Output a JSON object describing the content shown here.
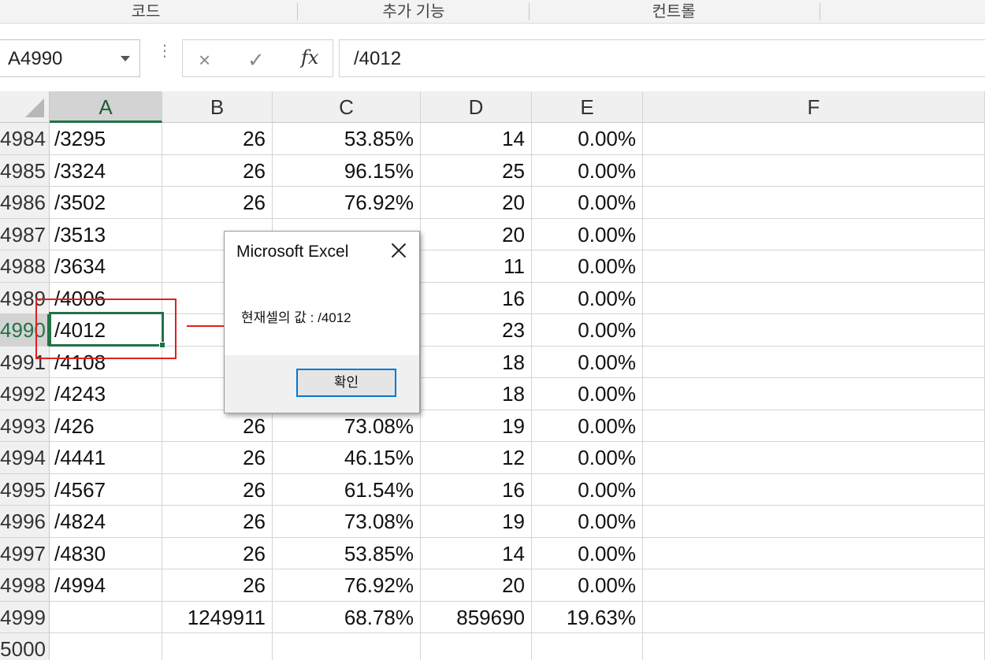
{
  "ribbon": {
    "groups": [
      "코드",
      "추가 기능",
      "컨트롤"
    ]
  },
  "formula_bar": {
    "name_box": "A4990",
    "cancel_icon": "×",
    "enter_icon": "✓",
    "fx_label": "fx",
    "formula": "/4012"
  },
  "grid": {
    "columns": [
      "A",
      "B",
      "C",
      "D",
      "E",
      "F"
    ],
    "selected_column": "A",
    "rows": [
      {
        "num": "4984",
        "a": "/3295",
        "b": "26",
        "c": "53.85%",
        "d": "14",
        "e": "0.00%"
      },
      {
        "num": "4985",
        "a": "/3324",
        "b": "26",
        "c": "96.15%",
        "d": "25",
        "e": "0.00%"
      },
      {
        "num": "4986",
        "a": "/3502",
        "b": "26",
        "c": "76.92%",
        "d": "20",
        "e": "0.00%"
      },
      {
        "num": "4987",
        "a": "/3513",
        "b": "",
        "c": "",
        "d": "20",
        "e": "0.00%"
      },
      {
        "num": "4988",
        "a": "/3634",
        "b": "",
        "c": "",
        "d": "11",
        "e": "0.00%"
      },
      {
        "num": "4989",
        "a": "/4006",
        "b": "",
        "c": "",
        "d": "16",
        "e": "0.00%"
      },
      {
        "num": "4990",
        "a": "/4012",
        "b": "",
        "c": "",
        "d": "23",
        "e": "0.00%"
      },
      {
        "num": "4991",
        "a": "/4108",
        "b": "",
        "c": "",
        "d": "18",
        "e": "0.00%"
      },
      {
        "num": "4992",
        "a": "/4243",
        "b": "",
        "c": "",
        "d": "18",
        "e": "0.00%"
      },
      {
        "num": "4993",
        "a": "/426",
        "b": "26",
        "c": "73.08%",
        "d": "19",
        "e": "0.00%"
      },
      {
        "num": "4994",
        "a": "/4441",
        "b": "26",
        "c": "46.15%",
        "d": "12",
        "e": "0.00%"
      },
      {
        "num": "4995",
        "a": "/4567",
        "b": "26",
        "c": "61.54%",
        "d": "16",
        "e": "0.00%"
      },
      {
        "num": "4996",
        "a": "/4824",
        "b": "26",
        "c": "73.08%",
        "d": "19",
        "e": "0.00%"
      },
      {
        "num": "4997",
        "a": "/4830",
        "b": "26",
        "c": "53.85%",
        "d": "14",
        "e": "0.00%"
      },
      {
        "num": "4998",
        "a": "/4994",
        "b": "26",
        "c": "76.92%",
        "d": "20",
        "e": "0.00%"
      },
      {
        "num": "4999",
        "a": "",
        "b": "1249911",
        "c": "68.78%",
        "d": "859690",
        "e": "19.63%"
      },
      {
        "num": "5000",
        "a": "",
        "b": "",
        "c": "",
        "d": "",
        "e": ""
      }
    ],
    "selected_row": "4990"
  },
  "dialog": {
    "title": "Microsoft Excel",
    "message": "현재셀의 값 : /4012",
    "ok_button": "확인"
  },
  "colors": {
    "selection_green": "#217346",
    "annotation_red": "#e02020",
    "dialog_button_border": "#0078d7"
  }
}
